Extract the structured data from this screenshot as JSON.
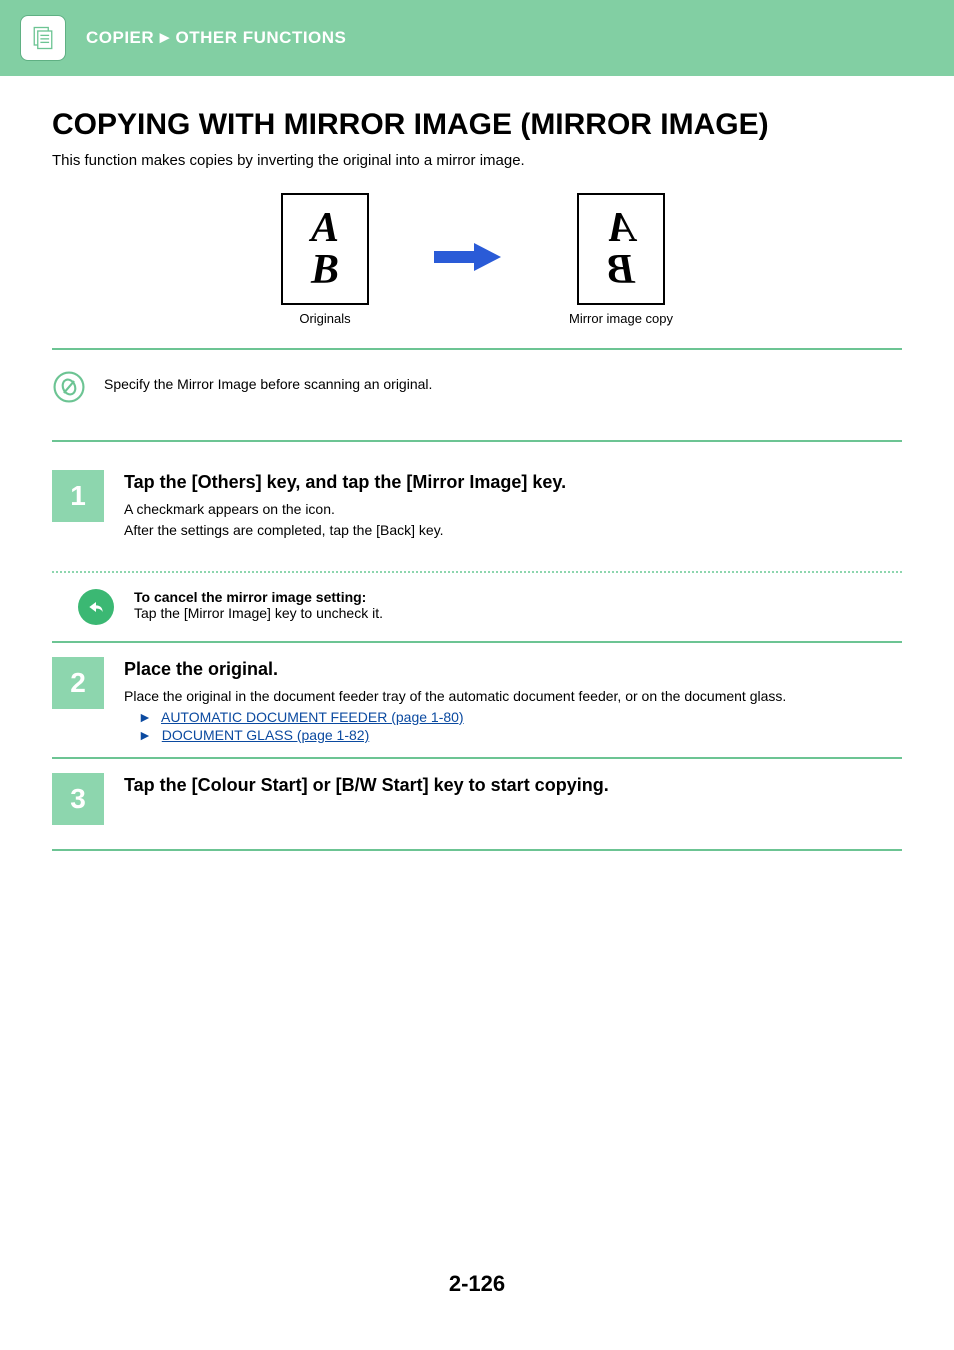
{
  "header": {
    "breadcrumb_part1": "COPIER",
    "breadcrumb_arrow": "►",
    "breadcrumb_part2": "OTHER FUNCTIONS"
  },
  "title": "COPYING WITH MIRROR IMAGE (MIRROR IMAGE)",
  "intro": "This function makes copies by inverting the original into a mirror image.",
  "diagram": {
    "original_A": "A",
    "original_B": "B",
    "label_original": "Originals",
    "label_mirror": "Mirror image copy"
  },
  "note1": "Specify the Mirror Image before scanning an original.",
  "steps": {
    "s1": {
      "num": "1",
      "title": "Tap the [Others] key, and tap the [Mirror Image] key.",
      "line1": "A checkmark appears on the icon.",
      "line2": "After the settings are completed, tap the [Back] key.",
      "cancel_title": "To cancel the mirror image setting:",
      "cancel_body": "Tap the [Mirror Image] key to uncheck it."
    },
    "s2": {
      "num": "2",
      "title": "Place the original.",
      "body": "Place the original in the document feeder tray of the automatic document feeder, or on the document glass.",
      "link1": "AUTOMATIC DOCUMENT FEEDER (page 1-80)",
      "link2": "DOCUMENT GLASS (page 1-82)"
    },
    "s3": {
      "num": "3",
      "title": "Tap the [Colour Start] or [B/W Start] key to start copying."
    }
  },
  "page_number": "2-126"
}
